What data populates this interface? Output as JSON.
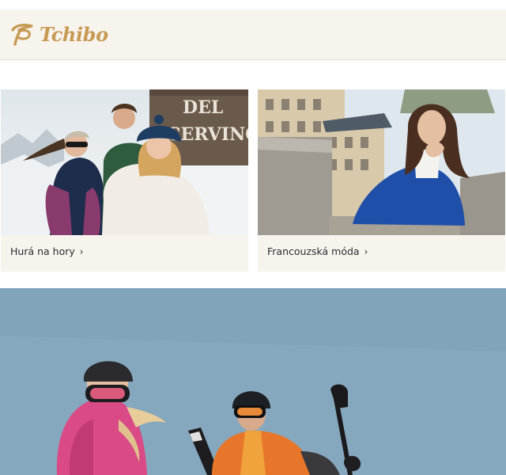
{
  "header": {
    "brand": "Tchibo",
    "logo_icon": "tchibo-cup-icon",
    "brand_color": "#c79a53",
    "background": "#f7f4ee"
  },
  "teasers": [
    {
      "label": "Hurá na hory",
      "chevron": "›",
      "image_sign": "DEL CERVINO"
    },
    {
      "label": "Francouzská móda",
      "chevron": "›"
    }
  ],
  "banner": {
    "sky_color": "#86a8be"
  }
}
